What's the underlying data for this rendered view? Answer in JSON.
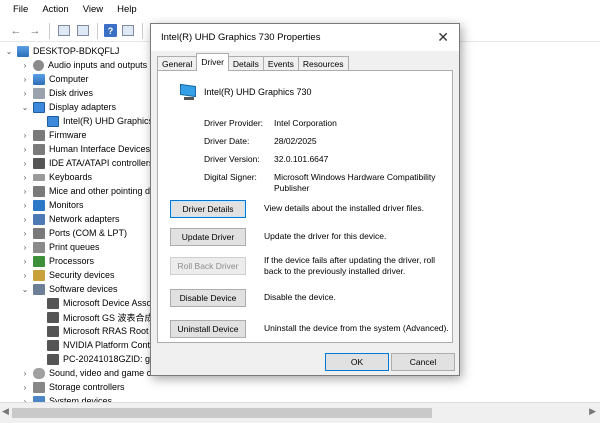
{
  "menu": [
    "File",
    "Action",
    "View",
    "Help"
  ],
  "toolbar": {
    "icons": [
      "back-arrow-icon",
      "forward-arrow-icon",
      "properties-icon",
      "list-icon",
      "help-icon",
      "list-view-icon",
      "monitor-icon"
    ]
  },
  "tree": {
    "root": "DESKTOP-BDKQFLJ",
    "items": [
      {
        "label": "Audio inputs and outputs",
        "expanded": false,
        "icon": "audio-icon"
      },
      {
        "label": "Computer",
        "expanded": false,
        "icon": "computer-icon"
      },
      {
        "label": "Disk drives",
        "expanded": false,
        "icon": "disk-icon"
      },
      {
        "label": "Display adapters",
        "expanded": true,
        "icon": "display-adapter-icon"
      },
      {
        "label": "Intel(R) UHD Graphics 730",
        "child": true,
        "icon": "display-adapter-icon"
      },
      {
        "label": "Firmware",
        "expanded": false,
        "icon": "firmware-icon"
      },
      {
        "label": "Human Interface Devices",
        "expanded": false,
        "icon": "hid-icon"
      },
      {
        "label": "IDE ATA/ATAPI controllers",
        "expanded": false,
        "icon": "ide-icon"
      },
      {
        "label": "Keyboards",
        "expanded": false,
        "icon": "keyboard-icon"
      },
      {
        "label": "Mice and other pointing devices",
        "expanded": false,
        "icon": "mouse-icon"
      },
      {
        "label": "Monitors",
        "expanded": false,
        "icon": "monitor-icon"
      },
      {
        "label": "Network adapters",
        "expanded": false,
        "icon": "network-icon"
      },
      {
        "label": "Ports (COM & LPT)",
        "expanded": false,
        "icon": "port-icon"
      },
      {
        "label": "Print queues",
        "expanded": false,
        "icon": "printer-icon"
      },
      {
        "label": "Processors",
        "expanded": false,
        "icon": "processor-icon"
      },
      {
        "label": "Security devices",
        "expanded": false,
        "icon": "security-icon"
      },
      {
        "label": "Software devices",
        "expanded": true,
        "icon": "software-icon"
      },
      {
        "label": "Microsoft Device Association Root Enumerator",
        "child": true,
        "icon": "device-icon"
      },
      {
        "label": "Microsoft GS 波表合成器",
        "child": true,
        "icon": "device-icon"
      },
      {
        "label": "Microsoft RRAS Root Enumerator",
        "child": true,
        "icon": "device-icon"
      },
      {
        "label": "NVIDIA Platform Controllers and Framework",
        "child": true,
        "icon": "device-icon"
      },
      {
        "label": "PC-20241018GZID: g",
        "child": true,
        "icon": "device-icon"
      },
      {
        "label": "Sound, video and game controllers",
        "expanded": false,
        "icon": "sound-icon"
      },
      {
        "label": "Storage controllers",
        "expanded": false,
        "icon": "storage-icon"
      },
      {
        "label": "System devices",
        "expanded": false,
        "icon": "system-icon"
      }
    ]
  },
  "dialog": {
    "title": "Intel(R) UHD Graphics 730 Properties",
    "tabs": [
      "General",
      "Driver",
      "Details",
      "Events",
      "Resources"
    ],
    "active_tab": "Driver",
    "device_name": "Intel(R) UHD Graphics 730",
    "info": [
      {
        "label": "Driver Provider:",
        "value": "Intel Corporation"
      },
      {
        "label": "Driver Date:",
        "value": "28/02/2025"
      },
      {
        "label": "Driver Version:",
        "value": "32.0.101.6647"
      },
      {
        "label": "Digital Signer:",
        "value": "Microsoft Windows Hardware Compatibility Publisher"
      }
    ],
    "actions": [
      {
        "button": "Driver Details",
        "desc": "View details about the installed driver files."
      },
      {
        "button": "Update Driver",
        "desc": "Update the driver for this device."
      },
      {
        "button": "Roll Back Driver",
        "desc": "If the device fails after updating the driver, roll back to the previously installed driver."
      },
      {
        "button": "Disable Device",
        "desc": "Disable the device."
      },
      {
        "button": "Uninstall Device",
        "desc": "Uninstall the device from the system (Advanced)."
      }
    ],
    "ok": "OK",
    "cancel": "Cancel"
  }
}
